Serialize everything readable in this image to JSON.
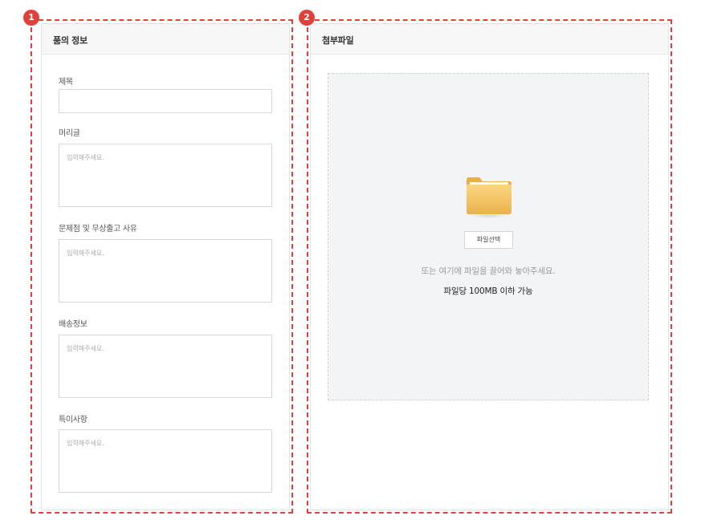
{
  "badges": [
    "1",
    "2"
  ],
  "product_info": {
    "title": "품의 정보",
    "fields": {
      "subject": {
        "label": "제목",
        "value": ""
      },
      "preface": {
        "label": "머리글",
        "placeholder": "입력해주세요."
      },
      "issue": {
        "label": "문제점 및 무상출고 사유",
        "placeholder": "입력해주세요."
      },
      "shipping": {
        "label": "배송정보",
        "placeholder": "입력해주세요."
      },
      "notes": {
        "label": "특이사항",
        "placeholder": "입력해주세요."
      }
    }
  },
  "attachments": {
    "title": "첨부파일",
    "select_button": "파일선택",
    "drop_hint": "또는 여기에 파일을 끌어와 놓아주세요.",
    "size_limit": "파일당 100MB 이하 가능",
    "icon": "folder-icon"
  },
  "colors": {
    "annotation_red": "#e0413b",
    "folder_yellow": "#f5c563",
    "header_bg": "#f7f7f7",
    "dropzone_bg": "#f3f4f6"
  }
}
